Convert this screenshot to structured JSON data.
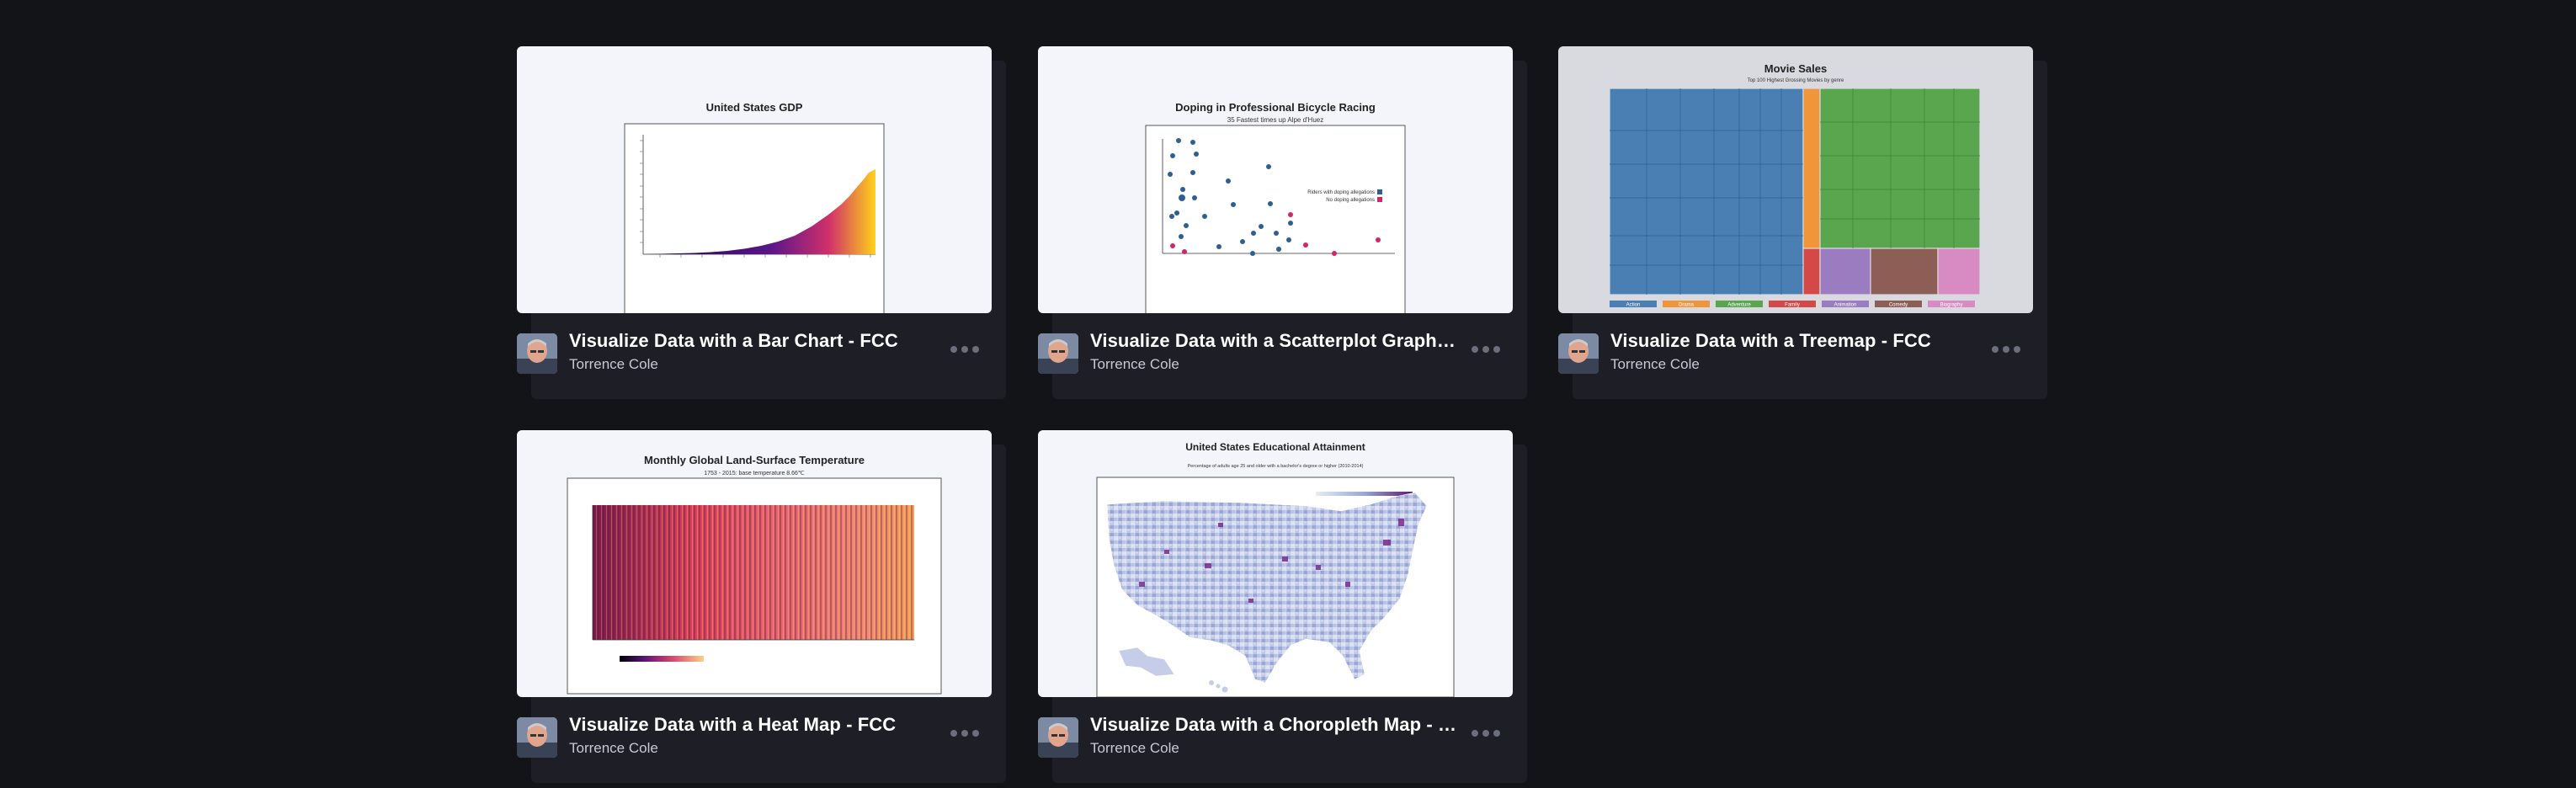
{
  "pens": [
    {
      "title": "Visualize Data with a Bar Chart - FCC",
      "author": "Torrence Cole",
      "preview": {
        "title": "United States GDP"
      }
    },
    {
      "title": "Visualize Data with a Scatterplot Graph - FCC",
      "author": "Torrence Cole",
      "preview": {
        "title": "Doping in Professional Bicycle Racing",
        "subtitle": "35 Fastest times up Alpe d'Huez",
        "legend": [
          "Riders with doping allegations",
          "No doping allegations"
        ]
      }
    },
    {
      "title": "Visualize Data with a Treemap - FCC",
      "author": "Torrence Cole",
      "preview": {
        "title": "Movie Sales",
        "subtitle": "Top 100 Highest Grossing Movies by genre",
        "legend": [
          "Action",
          "Drama",
          "Adventure",
          "Family",
          "Animation",
          "Comedy",
          "Biography"
        ]
      }
    },
    {
      "title": "Visualize Data with a Heat Map - FCC",
      "author": "Torrence Cole",
      "preview": {
        "title": "Monthly Global Land-Surface Temperature",
        "subtitle": "1753 - 2015: base temperature 8.66℃"
      }
    },
    {
      "title": "Visualize Data with a Choropleth Map - FCC",
      "author": "Torrence Cole",
      "preview": {
        "title": "United States Educational Attainment",
        "subtitle": "Percentage of adults age 25 and older with a bachelor's degree or higher (2010-2014)"
      }
    }
  ],
  "icons": {
    "avatar": "user-photo-avatar",
    "more": "more-options-icon"
  },
  "colors": {
    "background": "#131417",
    "card_footer": "#1e1f26",
    "preview_bg": "#f4f5fb",
    "title_text": "#ffffff",
    "author_text": "#c7c9d3",
    "dots": "#6b6f7d"
  }
}
